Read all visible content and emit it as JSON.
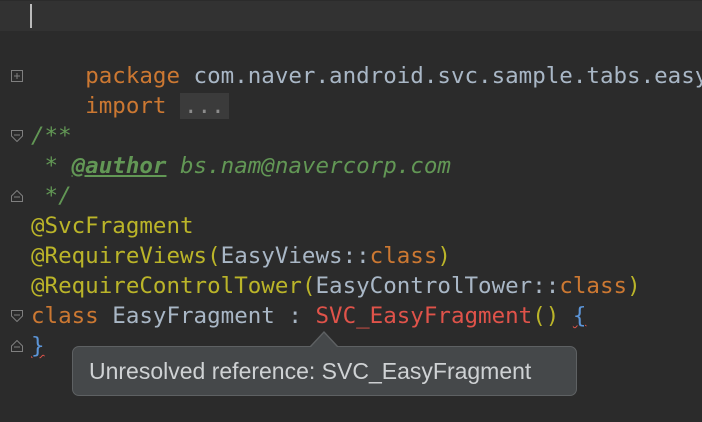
{
  "editor": {
    "line_package": {
      "keyword": "package",
      "name": " com.naver.android.svc.sample.tabs.easy"
    },
    "line_import": {
      "keyword": "import",
      "folded": "..."
    },
    "line_doc_open": "/**",
    "line_doc_author": {
      "prefix": " * ",
      "tag": "@author",
      "value": " bs.nam@navercorp.com"
    },
    "line_doc_close": " */",
    "line_annotation1": "@SvcFragment",
    "line_annotation2": {
      "name": "@RequireViews",
      "open": "(",
      "arg": "EasyViews::",
      "arg_kw": "class",
      "close": ")"
    },
    "line_annotation3": {
      "name": "@RequireControlTower",
      "open": "(",
      "arg": "EasyControlTower::",
      "arg_kw": "class",
      "close": ")"
    },
    "line_class": {
      "keyword": "class",
      "name": " EasyFragment : ",
      "super": "SVC_EasyFragment",
      "call": "()",
      "space": " ",
      "brace": "{"
    },
    "line_close": "}"
  },
  "tooltip": {
    "text": "Unresolved reference: SVC_EasyFragment"
  },
  "colors": {
    "background": "#2b2b2b",
    "keyword": "#cc7832",
    "annotation": "#bbb529",
    "doc_comment": "#629755",
    "error": "#e0534a",
    "text": "#a9b7c6"
  }
}
